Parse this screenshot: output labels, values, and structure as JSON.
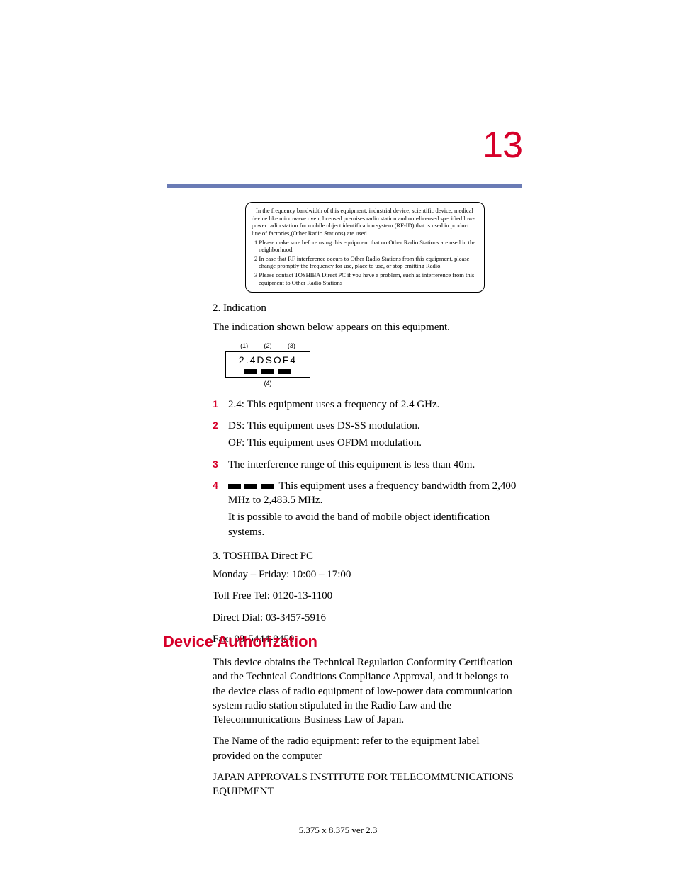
{
  "page_number": "13",
  "notice": {
    "p1": "In the frequency bandwidth of this equipment, industrial device, scientific device, medical device like microwave oven, licensed premises radio station and non-licensed specified low-power radio station for mobile object identification system (RF-ID) that is used in product line of factories,(Other Radio Stations) are used.",
    "i1": "1 Please make sure before using this equipment that no Other Radio Stations are used in the neighborhood.",
    "i2": "2 In case that RF interference occurs to Other Radio Stations from this equipment, please change promptly the frequency for use, place to use, or stop emitting Radio.",
    "i3": "3 Please contact TOSHIBA Direct PC if you have a problem, such as interference from this equipment to Other Radio Stations"
  },
  "section2": {
    "heading": "2. Indication",
    "intro": "The indication shown below appears on this equipment."
  },
  "label": {
    "m1": "(1)",
    "m2": "(2)",
    "m3": "(3)",
    "m4": "(4)",
    "text": "2.4DSOF4"
  },
  "list": {
    "n1": "1",
    "t1": "2.4: This equipment uses a frequency of 2.4 GHz.",
    "n2": "2",
    "t2a": "DS: This equipment uses DS-SS modulation.",
    "t2b": "OF: This equipment uses OFDM modulation.",
    "n3": "3",
    "t3": "The interference range of this equipment is less than 40m.",
    "n4": "4",
    "t4a": "This equipment uses a frequency bandwidth from 2,400 MHz to 2,483.5 MHz.",
    "t4b": "It is possible to avoid the band of mobile object identification systems."
  },
  "section3": {
    "heading": "3. TOSHIBA Direct PC",
    "hours": "Monday – Friday: 10:00 – 17:00",
    "tollfree": "Toll Free Tel: 0120-13-1100",
    "direct": "Direct Dial: 03-3457-5916",
    "fax": "Fax: 03-5444-9450"
  },
  "auth": {
    "heading": "Device Authorization",
    "p1": "This device obtains the Technical Regulation Conformity Certification and the Technical Conditions Compliance Approval, and it belongs to the device class of radio equipment of low-power data communication system radio station stipulated in the Radio Law and the Telecommunications Business Law of Japan.",
    "p2": "The Name of the radio equipment: refer to the equipment label provided on the computer",
    "p3": "JAPAN APPROVALS INSTITUTE FOR TELECOMMUNICATIONS EQUIPMENT"
  },
  "footer": "5.375 x 8.375 ver 2.3"
}
